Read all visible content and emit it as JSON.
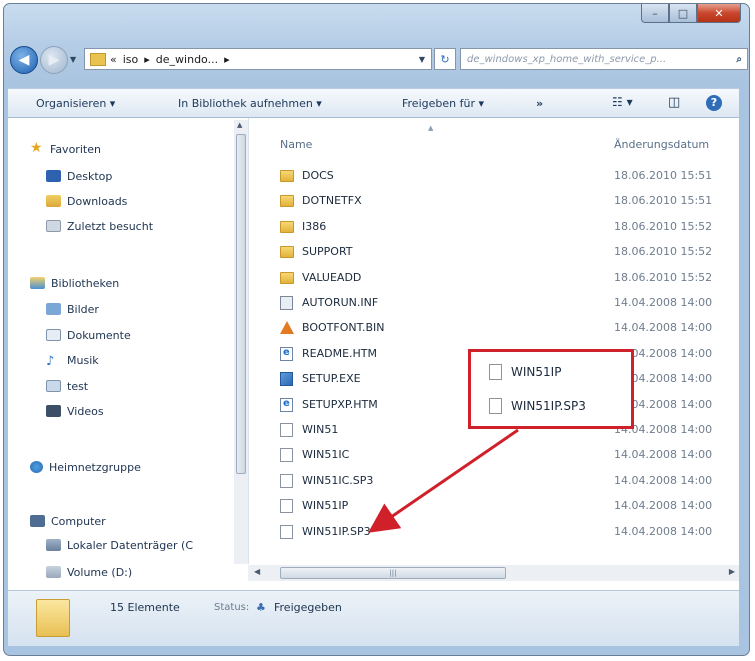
{
  "window": {
    "caption_buttons": {
      "minimize": "–",
      "maximize": "□",
      "close": "✕"
    }
  },
  "navigation": {
    "back_icon": "◀",
    "forward_icon": "▶",
    "address": {
      "crumbs": [
        "«",
        "iso",
        "▸",
        "de_windo...",
        "▸"
      ]
    },
    "search_placeholder": "de_windows_xp_home_with_service_p..."
  },
  "command_bar": {
    "organize": "Organisieren ▾",
    "library": "In Bibliothek aufnehmen ▾",
    "share": "Freigeben für ▾",
    "more": "»"
  },
  "nav_pane": {
    "favorites": "Favoriten",
    "desktop": "Desktop",
    "downloads": "Downloads",
    "recent": "Zuletzt besucht",
    "libraries": "Bibliotheken",
    "pictures": "Bilder",
    "documents": "Dokumente",
    "music": "Musik",
    "test": "test",
    "videos": "Videos",
    "homegroup": "Heimnetzgruppe",
    "computer": "Computer",
    "local_disk": "Lokaler Datenträger (C",
    "volume": "Volume (D:)"
  },
  "file_list": {
    "col_name": "Name",
    "col_date": "Änderungsdatum",
    "files": [
      {
        "name": "DOCS",
        "date": "18.06.2010 15:51",
        "type": "folder"
      },
      {
        "name": "DOTNETFX",
        "date": "18.06.2010 15:51",
        "type": "folder"
      },
      {
        "name": "I386",
        "date": "18.06.2010 15:52",
        "type": "folder"
      },
      {
        "name": "SUPPORT",
        "date": "18.06.2010 15:52",
        "type": "folder"
      },
      {
        "name": "VALUEADD",
        "date": "18.06.2010 15:52",
        "type": "folder"
      },
      {
        "name": "AUTORUN.INF",
        "date": "14.04.2008 14:00",
        "type": "inf"
      },
      {
        "name": "BOOTFONT.BIN",
        "date": "14.04.2008 14:00",
        "type": "bin"
      },
      {
        "name": "README.HTM",
        "date": "14.04.2008 14:00",
        "type": "htm"
      },
      {
        "name": "SETUP.EXE",
        "date": "14.04.2008 14:00",
        "type": "exe"
      },
      {
        "name": "SETUPXP.HTM",
        "date": "14.04.2008 14:00",
        "type": "htm"
      },
      {
        "name": "WIN51",
        "date": "14.04.2008 14:00",
        "type": "file"
      },
      {
        "name": "WIN51IC",
        "date": "14.04.2008 14:00",
        "type": "file"
      },
      {
        "name": "WIN51IC.SP3",
        "date": "14.04.2008 14:00",
        "type": "file"
      },
      {
        "name": "WIN51IP",
        "date": "14.04.2008 14:00",
        "type": "file"
      },
      {
        "name": "WIN51IP.SP3",
        "date": "14.04.2008 14:00",
        "type": "file"
      }
    ]
  },
  "callout": {
    "item1": "WIN51IP",
    "item2": "WIN51IP.SP3",
    "color": "#d0202a"
  },
  "status_bar": {
    "count": "15 Elemente",
    "status_label": "Status:",
    "status_value": "Freigegeben"
  }
}
